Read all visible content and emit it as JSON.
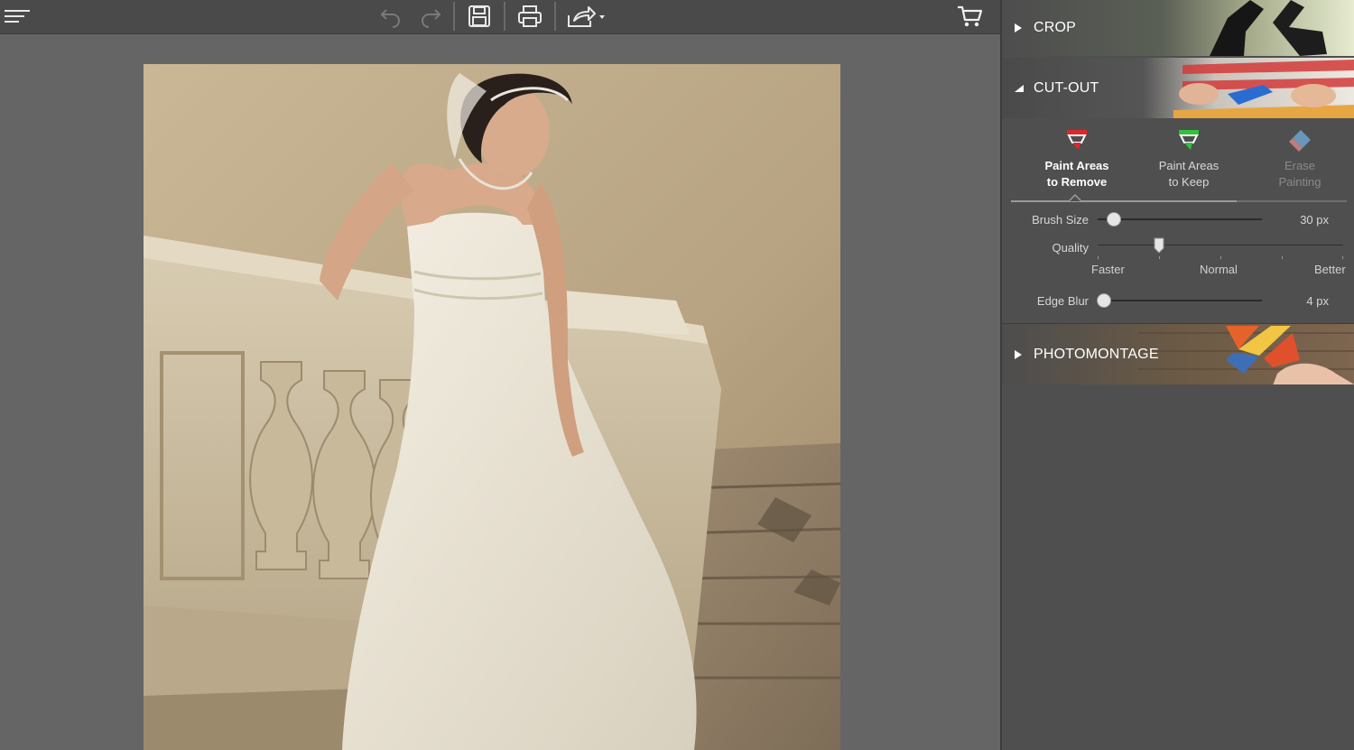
{
  "toolbar": {
    "menu_icon": "hamburger-menu-icon",
    "undo_icon": "undo-icon",
    "redo_icon": "redo-icon",
    "save_icon": "save-icon",
    "print_icon": "print-icon",
    "share_icon": "share-icon",
    "cart_icon": "shopping-cart-icon"
  },
  "panel": {
    "crop": {
      "title": "CROP",
      "expanded": false
    },
    "cutout": {
      "title": "CUT-OUT",
      "expanded": true,
      "tools": [
        {
          "line1": "Paint Areas",
          "line2": "to Remove",
          "icon": "marker-red-icon",
          "state": "active"
        },
        {
          "line1": "Paint Areas",
          "line2": "to Keep",
          "icon": "marker-green-icon",
          "state": "normal"
        },
        {
          "line1": "Erase",
          "line2": "Painting",
          "icon": "eraser-icon",
          "state": "disabled"
        }
      ],
      "brush_size": {
        "label": "Brush Size",
        "value_text": "30 px",
        "level": 0.1
      },
      "quality": {
        "label": "Quality",
        "level": 0.25,
        "ticks": [
          "Faster",
          "Normal",
          "Better"
        ]
      },
      "edge_blur": {
        "label": "Edge Blur",
        "value_text": "4 px",
        "level": 0.04
      }
    },
    "photomontage": {
      "title": "PHOTOMONTAGE",
      "expanded": false
    }
  },
  "colors": {
    "toolbar_bg": "#4a4a4a",
    "workspace_bg": "#656565",
    "panel_bg": "#4f4f4f",
    "marker_red": "#e0252b",
    "marker_green": "#2fc23a",
    "eraser_blue": "#6ea9d6"
  }
}
